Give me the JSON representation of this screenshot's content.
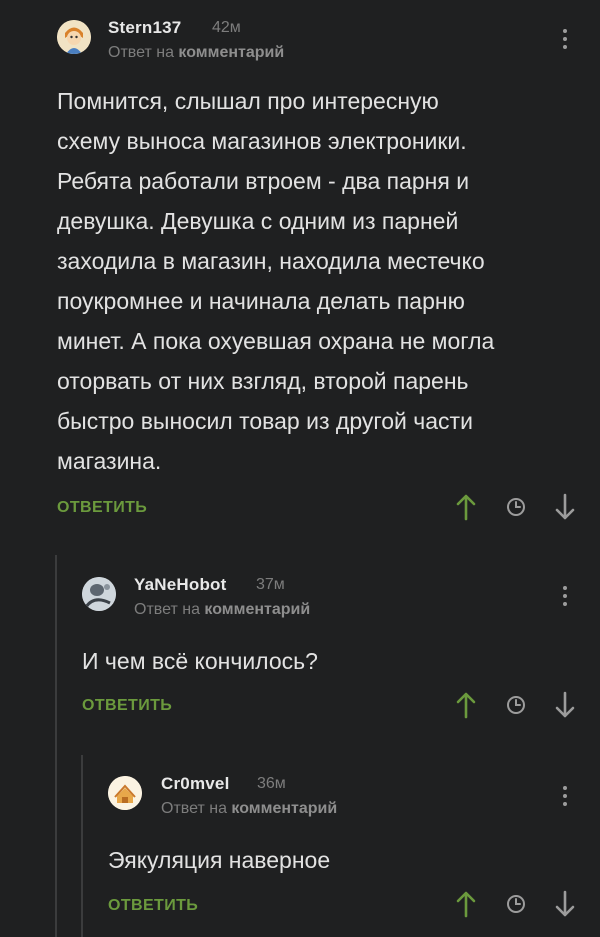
{
  "comments": [
    {
      "username": "Stern137",
      "time": "42м",
      "reply_prefix": "Ответ на",
      "reply_target": "комментарий",
      "text": "Помнится, слышал про интересную\nсхему выноса магазинов электроники.\nРебята работали втроем - два парня и\nдевушка. Девушка с одним из парней\nзаходила в магазин, находила местечко\nпоукромнее и начинала делать парню\nминет. А пока охуевшая охрана не могла\nоторвать от них взгляд, второй парень\nбыстро выносил товар из другой части\nмагазина.",
      "reply_label": "ОТВЕТИТЬ"
    },
    {
      "username": "YaNeHobot",
      "time": "37м",
      "reply_prefix": "Ответ на",
      "reply_target": "комментарий",
      "text": "И чем всё кончилось?",
      "reply_label": "ОТВЕТИТЬ"
    },
    {
      "username": "Cr0mvel",
      "time": "36м",
      "reply_prefix": "Ответ на",
      "reply_target": "комментарий",
      "text": "Эякуляция наверное",
      "reply_label": "ОТВЕТИТЬ"
    }
  ],
  "colors": {
    "background": "#1f2021",
    "accent_green": "#6b9a3d",
    "muted_text": "#7d7d7d"
  },
  "icons": [
    "upvote-arrow-icon",
    "clock-icon",
    "downvote-arrow-icon",
    "more-vertical-icon"
  ]
}
